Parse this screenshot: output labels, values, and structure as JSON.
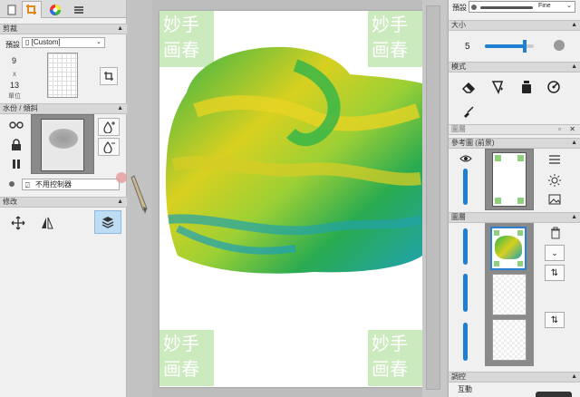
{
  "left_panel": {
    "tabs": [
      {
        "icon": "page-icon"
      },
      {
        "icon": "crop-icon"
      },
      {
        "icon": "color-wheel-icon"
      },
      {
        "icon": "menu-icon"
      }
    ],
    "crop_section": {
      "title": "剪裁",
      "preset_label": "預設",
      "preset_value": "[Custom]",
      "width": "9",
      "times": "x",
      "height": "13",
      "unit_label": "單位"
    },
    "watermark_section": {
      "title": "水份 / 傾斜",
      "control_option": "不用控制器"
    },
    "modify_section": {
      "title": "修改"
    }
  },
  "right_panel": {
    "preset_label": "預設",
    "brush_name": "Fine",
    "size_section": {
      "title": "大小",
      "value": "5",
      "slider_fraction": 0.82
    },
    "mode_section": {
      "title": "模式"
    },
    "layers_window": {
      "title": "圖層"
    },
    "reference_section": {
      "title": "參考圖 (前景)"
    },
    "layer_section": {
      "title": "圖層"
    },
    "blend_section": {
      "title": "調控",
      "sub_label": "互動"
    }
  },
  "canvas": {
    "watermark_text": [
      "妙手",
      "画春"
    ],
    "colors": {
      "paint_green": "#32b44a",
      "paint_yellow": "#e0cf1c",
      "paint_teal": "#1fa6b4",
      "watermark": "#bfe3b0"
    }
  }
}
